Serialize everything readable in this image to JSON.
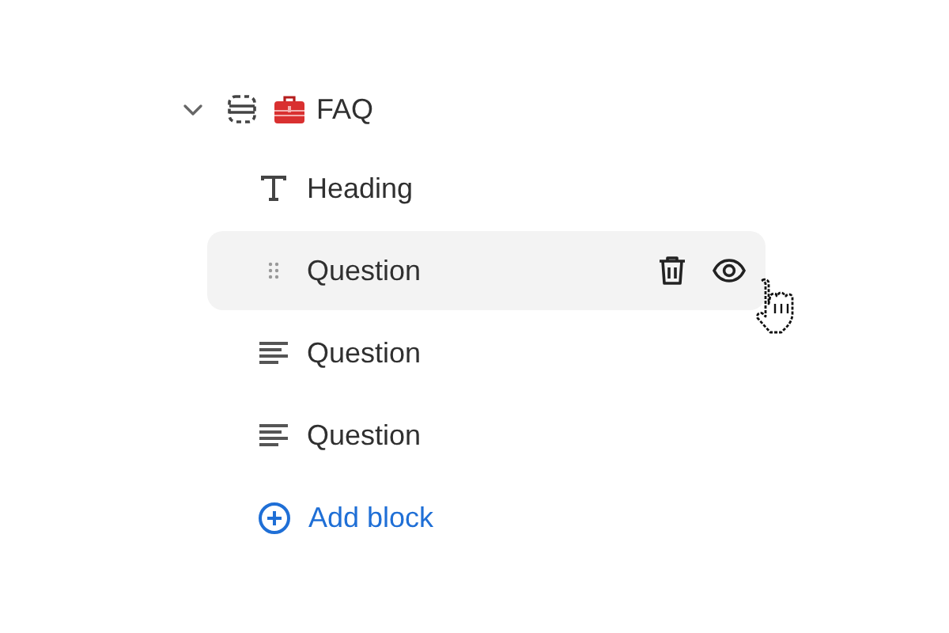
{
  "section": {
    "title": "FAQ",
    "expanded": true,
    "blocks": [
      {
        "kind": "heading",
        "label": "Heading",
        "hovered": false
      },
      {
        "label": "Question",
        "hovered": true
      },
      {
        "kind": "text",
        "label": "Question",
        "hovered": false
      },
      {
        "kind": "text",
        "label": "Question",
        "hovered": false
      }
    ],
    "add_button": {
      "label": "Add block"
    }
  }
}
